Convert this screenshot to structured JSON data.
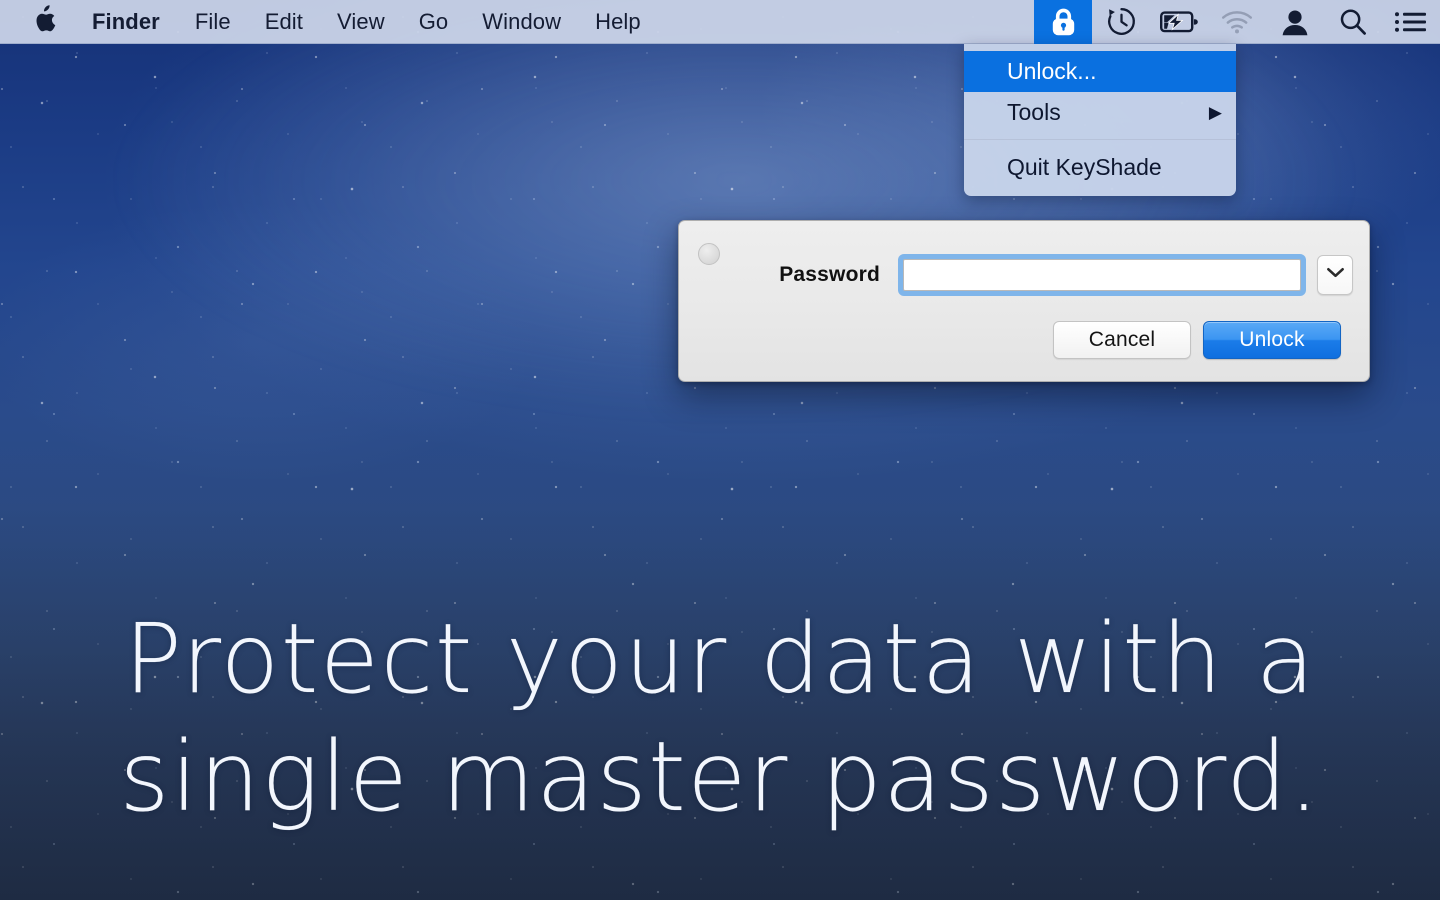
{
  "menubar": {
    "apple_icon": "apple-logo-icon",
    "items": [
      {
        "label": "Finder",
        "bold": true
      },
      {
        "label": "File",
        "bold": false
      },
      {
        "label": "Edit",
        "bold": false
      },
      {
        "label": "View",
        "bold": false
      },
      {
        "label": "Go",
        "bold": false
      },
      {
        "label": "Window",
        "bold": false
      },
      {
        "label": "Help",
        "bold": false
      }
    ],
    "status_items": [
      {
        "name": "keyshade-lock-icon",
        "active": true
      },
      {
        "name": "time-machine-icon",
        "active": false
      },
      {
        "name": "battery-charging-icon",
        "active": false
      },
      {
        "name": "wifi-icon",
        "active": false
      },
      {
        "name": "user-account-icon",
        "active": false
      },
      {
        "name": "spotlight-search-icon",
        "active": false
      },
      {
        "name": "notification-center-icon",
        "active": false
      }
    ],
    "background_color": "#cdd6e9",
    "text_color": "#141c33",
    "highlight_color": "#0a71e0"
  },
  "keyshade_menu": {
    "items": [
      {
        "label": "Unlock...",
        "highlighted": true,
        "has_submenu": false
      },
      {
        "label": "Tools",
        "highlighted": false,
        "has_submenu": true,
        "submenu_arrow": "▶"
      },
      {
        "label": "Quit KeyShade",
        "highlighted": false,
        "has_submenu": false
      }
    ],
    "separator_before_index": 2,
    "background_color": "#c7d3ea",
    "highlight_color": "#0a70e0"
  },
  "dialog": {
    "close_button": "close-button",
    "password_label": "Password",
    "password_value": "",
    "password_placeholder": "",
    "password_menu_icon": "chevron-down-icon",
    "cancel_label": "Cancel",
    "unlock_label": "Unlock",
    "background_color": "#ececec",
    "focus_ring_color": "#7fb5ea",
    "primary_button_color": "#1b7ce9"
  },
  "hero": {
    "line1": "Protect your data with a",
    "line2": "single master password.",
    "text_color": "#f2f6fd"
  },
  "desktop": {
    "wallpaper_name": "starfield-milky-way-wallpaper",
    "top_color": "#153177",
    "bottom_color": "#27364f"
  }
}
